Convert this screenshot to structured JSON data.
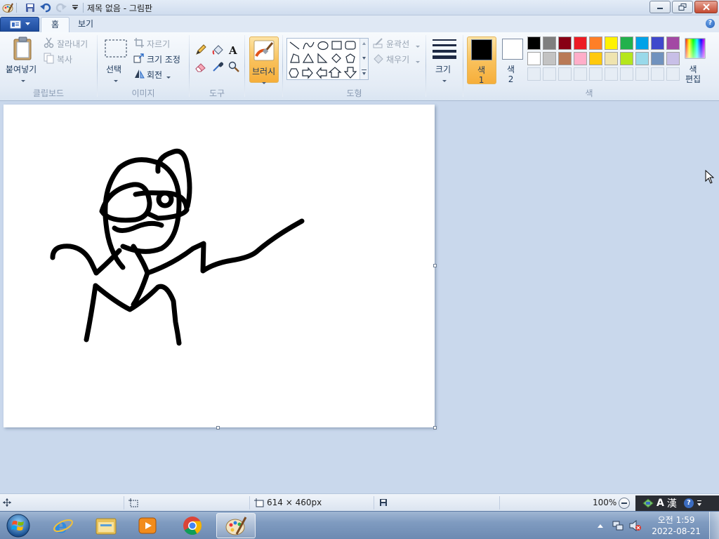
{
  "window": {
    "title": "제목 없음 - 그림판"
  },
  "tabs": {
    "home": "홈",
    "view": "보기"
  },
  "clipboard": {
    "paste": "붙여넣기",
    "cut": "잘라내기",
    "copy": "복사",
    "label": "클립보드"
  },
  "image": {
    "select": "선택",
    "crop": "자르기",
    "resize": "크기 조정",
    "rotate": "회전",
    "label": "이미지"
  },
  "tools": {
    "label": "도구"
  },
  "brushes": {
    "label": "브러시"
  },
  "shapes": {
    "outline": "윤곽선",
    "fill": "채우기",
    "label": "도형"
  },
  "size": {
    "label": "크기"
  },
  "colors": {
    "color1_label": "색\n1",
    "color1_line1": "색",
    "color1_line2": "1",
    "color2_line1": "색",
    "color2_line2": "2",
    "edit_line1": "색",
    "edit_line2": "편집",
    "label": "색",
    "color1": "#000000",
    "color2": "#ffffff",
    "palette_row1": [
      "#000000",
      "#7f7f7f",
      "#880015",
      "#ed1c24",
      "#ff7f27",
      "#fff200",
      "#22b14c",
      "#00a2e8",
      "#3f48cc",
      "#a349a4"
    ],
    "palette_row2": [
      "#ffffff",
      "#c3c3c3",
      "#b97a57",
      "#ffaec9",
      "#ffc90e",
      "#efe4b0",
      "#b5e61d",
      "#99d9ea",
      "#7092be",
      "#c8bfe7"
    ]
  },
  "status": {
    "canvas_size": "614 × 460px",
    "zoom": "100%"
  },
  "taskbar": {
    "time": "오전 1:59",
    "date": "2022-08-21"
  },
  "ime": {
    "mode": "A",
    "hanja": "漢"
  }
}
